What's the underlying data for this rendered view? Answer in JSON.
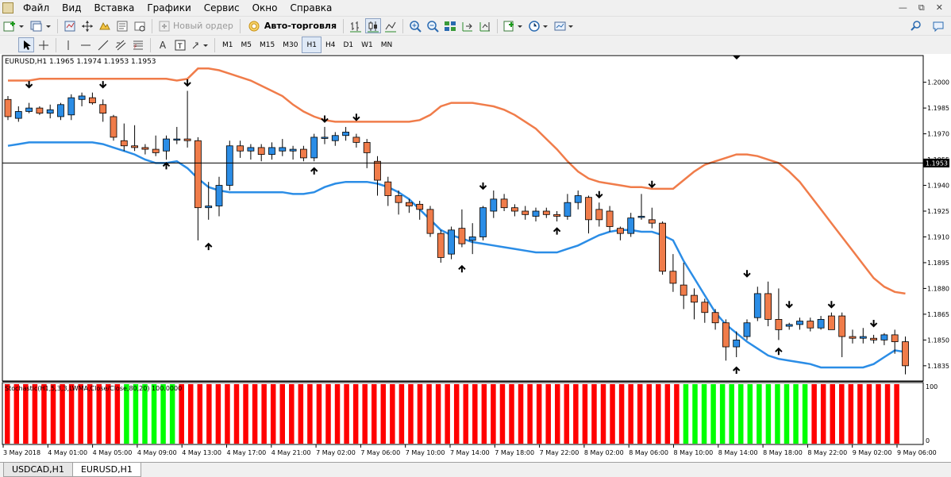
{
  "menu": [
    "Файл",
    "Вид",
    "Вставка",
    "Графики",
    "Сервис",
    "Окно",
    "Справка"
  ],
  "toolbar": {
    "new_order_label": "Новый ордер",
    "autotrade_label": "Авто-торговля",
    "timeframes": [
      "M1",
      "M5",
      "M15",
      "M30",
      "H1",
      "H4",
      "D1",
      "W1",
      "MN"
    ],
    "active_timeframe": "H1"
  },
  "chart": {
    "header": "EURUSD,H1  1.1965 1.1974 1.1953 1.1953",
    "current_price": "1.1953",
    "price_ticks": [
      "1.2000",
      "1.1985",
      "1.1970",
      "1.1955",
      "1.1940",
      "1.1925",
      "1.1910",
      "1.1895",
      "1.1880",
      "1.1865",
      "1.1850",
      "1.1835"
    ],
    "time_labels": [
      "3 May 2018",
      "4 May 01:00",
      "4 May 05:00",
      "4 May 09:00",
      "4 May 13:00",
      "4 May 17:00",
      "4 May 21:00",
      "7 May 02:00",
      "7 May 06:00",
      "7 May 10:00",
      "7 May 14:00",
      "7 May 18:00",
      "7 May 22:00",
      "8 May 02:00",
      "8 May 06:00",
      "8 May 10:00",
      "8 May 14:00",
      "8 May 18:00",
      "8 May 22:00",
      "9 May 02:00",
      "9 May 06:00"
    ],
    "indicator_header": "Stochastic(H1,5,3,3,LWMA,Close/Close,80,20) 100.0000",
    "indicator_ticks": [
      "100",
      "0"
    ],
    "colors": {
      "bull": "#2b8de6",
      "bear": "#f07c4a",
      "upper_band": "#f07c4a",
      "lower_band": "#2b8de6",
      "stoch_green": "#00ff00",
      "stoch_red": "#ff0000"
    }
  },
  "chart_data": {
    "type": "candlestick",
    "symbol": "EURUSD",
    "timeframe": "H1",
    "ylim": [
      1.1828,
      1.201
    ],
    "candles": [
      [
        1.199,
        1.1992,
        1.1978,
        1.198
      ],
      [
        1.1979,
        1.1986,
        1.1977,
        1.1983
      ],
      [
        1.1983,
        1.1988,
        1.1982,
        1.1985
      ],
      [
        1.1985,
        1.1986,
        1.1981,
        1.1982
      ],
      [
        1.1982,
        1.1987,
        1.1979,
        1.1984
      ],
      [
        1.198,
        1.1988,
        1.1978,
        1.1987
      ],
      [
        1.1981,
        1.1993,
        1.1978,
        1.1991
      ],
      [
        1.199,
        1.1994,
        1.1986,
        1.1992
      ],
      [
        1.1991,
        1.1994,
        1.1987,
        1.1988
      ],
      [
        1.1987,
        1.199,
        1.1977,
        1.1982
      ],
      [
        1.198,
        1.1981,
        1.1966,
        1.1968
      ],
      [
        1.1966,
        1.1976,
        1.196,
        1.1963
      ],
      [
        1.1963,
        1.1975,
        1.196,
        1.1962
      ],
      [
        1.1962,
        1.1964,
        1.1958,
        1.1961
      ],
      [
        1.1961,
        1.1969,
        1.1957,
        1.1959
      ],
      [
        1.196,
        1.1969,
        1.1955,
        1.1967
      ],
      [
        1.1967,
        1.1974,
        1.1964,
        1.1967
      ],
      [
        1.1967,
        1.1995,
        1.1962,
        1.1966
      ],
      [
        1.1966,
        1.1968,
        1.1908,
        1.1927
      ],
      [
        1.1927,
        1.1942,
        1.192,
        1.1928
      ],
      [
        1.1928,
        1.1945,
        1.1922,
        1.194
      ],
      [
        1.194,
        1.1966,
        1.1937,
        1.1963
      ],
      [
        1.1963,
        1.1966,
        1.1956,
        1.196
      ],
      [
        1.196,
        1.1964,
        1.1955,
        1.1962
      ],
      [
        1.1962,
        1.1964,
        1.1954,
        1.1958
      ],
      [
        1.1958,
        1.1965,
        1.1955,
        1.1962
      ],
      [
        1.196,
        1.1967,
        1.1957,
        1.1962
      ],
      [
        1.196,
        1.1963,
        1.1955,
        1.1961
      ],
      [
        1.1961,
        1.1963,
        1.1954,
        1.1956
      ],
      [
        1.1956,
        1.197,
        1.1954,
        1.1968
      ],
      [
        1.1968,
        1.1974,
        1.1964,
        1.1968
      ],
      [
        1.1966,
        1.1971,
        1.1963,
        1.1969
      ],
      [
        1.1969,
        1.1974,
        1.1966,
        1.1971
      ],
      [
        1.1968,
        1.197,
        1.1962,
        1.1965
      ],
      [
        1.1965,
        1.1967,
        1.195,
        1.1959
      ],
      [
        1.1954,
        1.1957,
        1.1934,
        1.1943
      ],
      [
        1.1942,
        1.1945,
        1.1928,
        1.1934
      ],
      [
        1.1934,
        1.1937,
        1.1923,
        1.193
      ],
      [
        1.193,
        1.1932,
        1.1924,
        1.1928
      ],
      [
        1.1929,
        1.1931,
        1.192,
        1.1926
      ],
      [
        1.1926,
        1.1928,
        1.191,
        1.1912
      ],
      [
        1.1912,
        1.1914,
        1.1895,
        1.1898
      ],
      [
        1.19,
        1.1916,
        1.1897,
        1.1914
      ],
      [
        1.1915,
        1.1926,
        1.1904,
        1.1906
      ],
      [
        1.1908,
        1.1918,
        1.19,
        1.191
      ],
      [
        1.191,
        1.1928,
        1.1908,
        1.1927
      ],
      [
        1.1925,
        1.1937,
        1.1921,
        1.1932
      ],
      [
        1.1932,
        1.1935,
        1.1925,
        1.1927
      ],
      [
        1.1927,
        1.1929,
        1.1922,
        1.1925
      ],
      [
        1.1925,
        1.1928,
        1.192,
        1.1923
      ],
      [
        1.1922,
        1.1927,
        1.1919,
        1.1925
      ],
      [
        1.1925,
        1.1927,
        1.1921,
        1.1923
      ],
      [
        1.1923,
        1.1925,
        1.1919,
        1.1922
      ],
      [
        1.1922,
        1.1935,
        1.192,
        1.193
      ],
      [
        1.193,
        1.1937,
        1.1926,
        1.1934
      ],
      [
        1.1933,
        1.1934,
        1.1912,
        1.192
      ],
      [
        1.1926,
        1.193,
        1.1916,
        1.192
      ],
      [
        1.1925,
        1.1928,
        1.1913,
        1.1916
      ],
      [
        1.1915,
        1.1916,
        1.1908,
        1.1912
      ],
      [
        1.1912,
        1.1924,
        1.191,
        1.1921
      ],
      [
        1.1922,
        1.1935,
        1.192,
        1.1922
      ],
      [
        1.192,
        1.1927,
        1.1915,
        1.1918
      ],
      [
        1.1918,
        1.1919,
        1.1888,
        1.189
      ],
      [
        1.189,
        1.19,
        1.1878,
        1.1883
      ],
      [
        1.1882,
        1.1895,
        1.1868,
        1.1876
      ],
      [
        1.1876,
        1.188,
        1.1862,
        1.1872
      ],
      [
        1.1872,
        1.1874,
        1.186,
        1.1866
      ],
      [
        1.1866,
        1.1868,
        1.1856,
        1.186
      ],
      [
        1.186,
        1.1862,
        1.1838,
        1.1846
      ],
      [
        1.1846,
        1.1855,
        1.184,
        1.185
      ],
      [
        1.1852,
        1.1862,
        1.185,
        1.186
      ],
      [
        1.1863,
        1.1881,
        1.1861,
        1.1877
      ],
      [
        1.1877,
        1.1884,
        1.1858,
        1.1862
      ],
      [
        1.1862,
        1.188,
        1.185,
        1.1856
      ],
      [
        1.1858,
        1.186,
        1.1856,
        1.1859
      ],
      [
        1.1859,
        1.1863,
        1.1856,
        1.1861
      ],
      [
        1.1861,
        1.1863,
        1.1855,
        1.1857
      ],
      [
        1.1857,
        1.1864,
        1.1856,
        1.1862
      ],
      [
        1.1864,
        1.1866,
        1.1858,
        1.1856
      ],
      [
        1.1864,
        1.1866,
        1.184,
        1.1852
      ],
      [
        1.1852,
        1.1856,
        1.1848,
        1.1851
      ],
      [
        1.1851,
        1.1857,
        1.1848,
        1.1852
      ],
      [
        1.1851,
        1.1853,
        1.1848,
        1.185
      ],
      [
        1.185,
        1.1854,
        1.1847,
        1.1853
      ],
      [
        1.1853,
        1.1856,
        1.1842,
        1.1849
      ],
      [
        1.1849,
        1.1852,
        1.183,
        1.1835
      ]
    ],
    "upper_band": [
      1.2001,
      1.2001,
      1.2001,
      1.2002,
      1.2002,
      1.2002,
      1.2002,
      1.2002,
      1.2002,
      1.2002,
      1.2002,
      1.2002,
      1.2002,
      1.2002,
      1.2002,
      1.2002,
      1.2001,
      1.2002,
      1.2008,
      1.2008,
      1.2007,
      1.2005,
      1.2003,
      1.2001,
      1.1998,
      1.1995,
      1.1992,
      1.1987,
      1.1983,
      1.198,
      1.1978,
      1.1977,
      1.1977,
      1.1977,
      1.1977,
      1.1977,
      1.1977,
      1.1977,
      1.1977,
      1.1978,
      1.1981,
      1.1986,
      1.1988,
      1.1988,
      1.1988,
      1.1987,
      1.1986,
      1.1984,
      1.1981,
      1.1977,
      1.1973,
      1.1967,
      1.1961,
      1.1954,
      1.1948,
      1.1944,
      1.1942,
      1.1941,
      1.194,
      1.1939,
      1.1939,
      1.1938,
      1.1938,
      1.1938,
      1.1943,
      1.1948,
      1.1952,
      1.1954,
      1.1956,
      1.1958,
      1.1958,
      1.1957,
      1.1955,
      1.1953,
      1.1948,
      1.1942,
      1.1934,
      1.1926,
      1.1918,
      1.191,
      1.1902,
      1.1894,
      1.1886,
      1.1881,
      1.1878,
      1.1877
    ],
    "lower_band": [
      1.1963,
      1.1964,
      1.1965,
      1.1965,
      1.1965,
      1.1965,
      1.1965,
      1.1965,
      1.1965,
      1.1964,
      1.1962,
      1.196,
      1.1958,
      1.1955,
      1.1953,
      1.1953,
      1.1954,
      1.195,
      1.1944,
      1.1939,
      1.1937,
      1.1936,
      1.1936,
      1.1936,
      1.1936,
      1.1936,
      1.1936,
      1.1935,
      1.1935,
      1.1936,
      1.1939,
      1.1941,
      1.1942,
      1.1942,
      1.1942,
      1.1941,
      1.1939,
      1.1936,
      1.1932,
      1.1926,
      1.192,
      1.1914,
      1.1911,
      1.1909,
      1.1907,
      1.1906,
      1.1905,
      1.1904,
      1.1903,
      1.1902,
      1.1901,
      1.1901,
      1.1901,
      1.1903,
      1.1905,
      1.1908,
      1.1911,
      1.1913,
      1.1914,
      1.1914,
      1.1913,
      1.1913,
      1.1911,
      1.1908,
      1.1896,
      1.1886,
      1.1876,
      1.1866,
      1.1859,
      1.1854,
      1.1849,
      1.1845,
      1.1841,
      1.1839,
      1.1838,
      1.1837,
      1.1836,
      1.1834,
      1.1834,
      1.1834,
      1.1834,
      1.1834,
      1.1836,
      1.184,
      1.1844,
      1.1843
    ],
    "fractals_up": [
      [
        2,
        1.1997
      ],
      [
        9,
        1.1997
      ],
      [
        17,
        1.1998
      ],
      [
        30,
        1.1977
      ],
      [
        33,
        1.1978
      ],
      [
        45,
        1.1938
      ],
      [
        56,
        1.1933
      ],
      [
        61,
        1.1939
      ],
      [
        70,
        1.1887
      ],
      [
        74,
        1.1869
      ],
      [
        78,
        1.1869
      ],
      [
        82,
        1.1858
      ]
    ],
    "fractals_down": [
      [
        15,
        1.1953
      ],
      [
        19,
        1.1906
      ],
      [
        29,
        1.195
      ],
      [
        43,
        1.1893
      ],
      [
        52,
        1.1915
      ],
      [
        69,
        1.1834
      ],
      [
        73,
        1.1845
      ]
    ],
    "stochastic_colors": "RRRRRRRRRRRRRGGGGGGRRRRRRRRRRRRRRRRRRRRRRRRRRRRRRRRRRRRRRRRRRRRRRRRRRRRRRRGGGGGGGGGGGGGGRRRRRRRRRR",
    "stochastic_ylim": [
      0,
      100
    ]
  },
  "tabs": [
    "USDCAD,H1",
    "EURUSD,H1"
  ],
  "active_tab": "EURUSD,H1"
}
